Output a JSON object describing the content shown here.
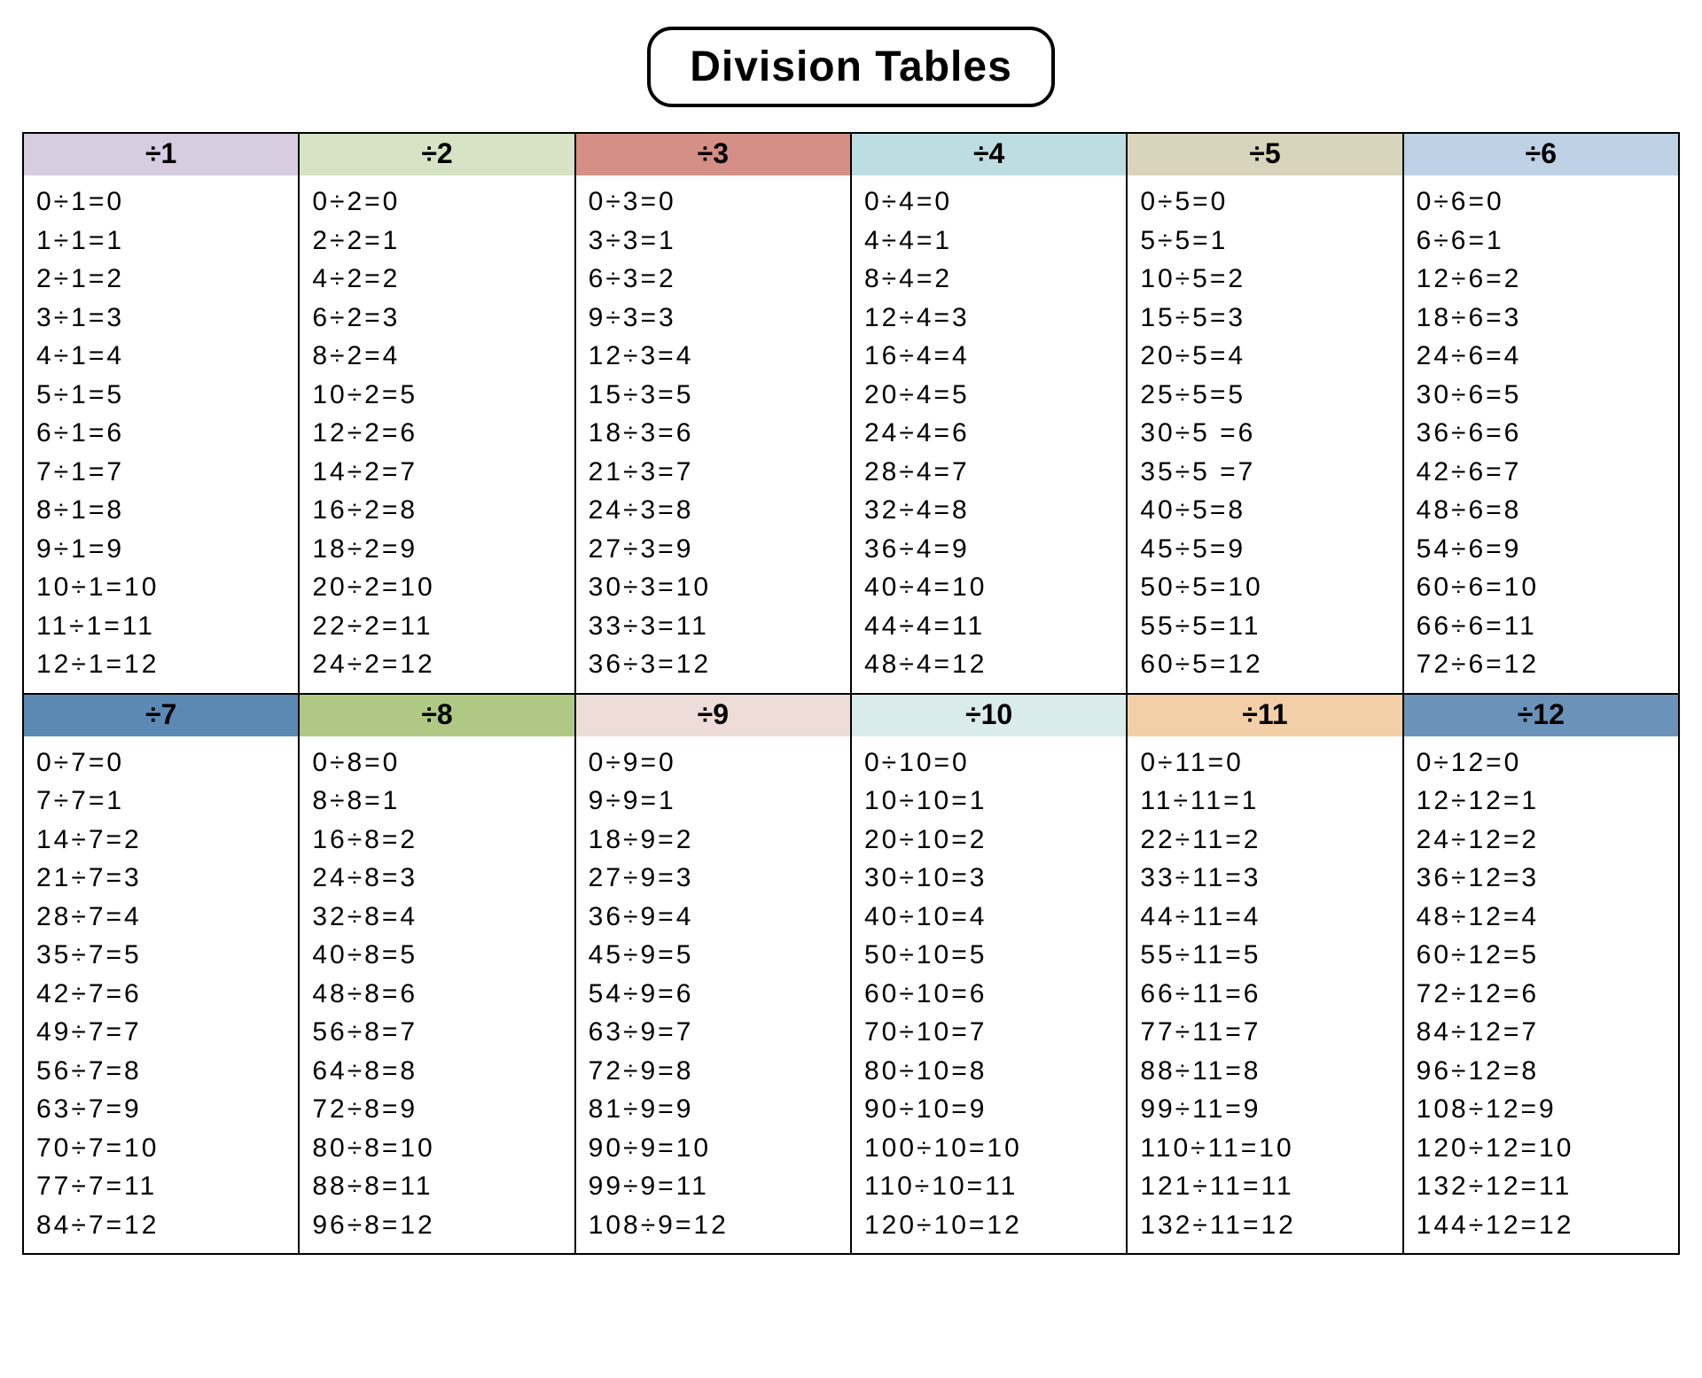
{
  "title": "Division Tables",
  "colors": [
    "#d8cde0",
    "#d6e3c4",
    "#d48f86",
    "#bedde2",
    "#d9d5bd",
    "#bed1e5",
    "#5b89b4",
    "#afc883",
    "#eddcd7",
    "#d9ebeb",
    "#f2cfa7",
    "#6b93ba"
  ],
  "tables": [
    {
      "divisor": 1,
      "header": "÷1",
      "rows": [
        "0÷1=0",
        "1÷1=1",
        "2÷1=2",
        "3÷1=3",
        "4÷1=4",
        "5÷1=5",
        "6÷1=6",
        "7÷1=7",
        "8÷1=8",
        "9÷1=9",
        "10÷1=10",
        "11÷1=11",
        "12÷1=12"
      ]
    },
    {
      "divisor": 2,
      "header": "÷2",
      "rows": [
        "0÷2=0",
        "2÷2=1",
        "4÷2=2",
        "6÷2=3",
        "8÷2=4",
        "10÷2=5",
        "12÷2=6",
        "14÷2=7",
        "16÷2=8",
        "18÷2=9",
        "20÷2=10",
        "22÷2=11",
        "24÷2=12"
      ]
    },
    {
      "divisor": 3,
      "header": "÷3",
      "rows": [
        "0÷3=0",
        "3÷3=1",
        "6÷3=2",
        "9÷3=3",
        "12÷3=4",
        "15÷3=5",
        "18÷3=6",
        "21÷3=7",
        "24÷3=8",
        "27÷3=9",
        "30÷3=10",
        "33÷3=11",
        "36÷3=12"
      ]
    },
    {
      "divisor": 4,
      "header": "÷4",
      "rows": [
        "0÷4=0",
        "4÷4=1",
        "8÷4=2",
        "12÷4=3",
        "16÷4=4",
        "20÷4=5",
        "24÷4=6",
        "28÷4=7",
        "32÷4=8",
        "36÷4=9",
        "40÷4=10",
        "44÷4=11",
        "48÷4=12"
      ]
    },
    {
      "divisor": 5,
      "header": "÷5",
      "rows": [
        "0÷5=0",
        "5÷5=1",
        "10÷5=2",
        "15÷5=3",
        "20÷5=4",
        "25÷5=5",
        "30÷5 =6",
        "35÷5 =7",
        "40÷5=8",
        "45÷5=9",
        "50÷5=10",
        "55÷5=11",
        "60÷5=12"
      ]
    },
    {
      "divisor": 6,
      "header": "÷6",
      "rows": [
        "0÷6=0",
        "6÷6=1",
        "12÷6=2",
        "18÷6=3",
        "24÷6=4",
        "30÷6=5",
        "36÷6=6",
        "42÷6=7",
        "48÷6=8",
        "54÷6=9",
        "60÷6=10",
        "66÷6=11",
        "72÷6=12"
      ]
    },
    {
      "divisor": 7,
      "header": "÷7",
      "rows": [
        "0÷7=0",
        "7÷7=1",
        "14÷7=2",
        "21÷7=3",
        "28÷7=4",
        "35÷7=5",
        "42÷7=6",
        "49÷7=7",
        "56÷7=8",
        "63÷7=9",
        "70÷7=10",
        "77÷7=11",
        "84÷7=12"
      ]
    },
    {
      "divisor": 8,
      "header": "÷8",
      "rows": [
        "0÷8=0",
        "8÷8=1",
        "16÷8=2",
        "24÷8=3",
        "32÷8=4",
        "40÷8=5",
        "48÷8=6",
        "56÷8=7",
        "64÷8=8",
        "72÷8=9",
        "80÷8=10",
        "88÷8=11",
        "96÷8=12"
      ]
    },
    {
      "divisor": 9,
      "header": "÷9",
      "rows": [
        "0÷9=0",
        "9÷9=1",
        "18÷9=2",
        "27÷9=3",
        "36÷9=4",
        "45÷9=5",
        "54÷9=6",
        "63÷9=7",
        "72÷9=8",
        "81÷9=9",
        "90÷9=10",
        "99÷9=11",
        "108÷9=12"
      ]
    },
    {
      "divisor": 10,
      "header": "÷10",
      "rows": [
        "0÷10=0",
        "10÷10=1",
        "20÷10=2",
        "30÷10=3",
        "40÷10=4",
        "50÷10=5",
        "60÷10=6",
        "70÷10=7",
        "80÷10=8",
        "90÷10=9",
        "100÷10=10",
        "110÷10=11",
        "120÷10=12"
      ]
    },
    {
      "divisor": 11,
      "header": "÷11",
      "rows": [
        "0÷11=0",
        "11÷11=1",
        "22÷11=2",
        "33÷11=3",
        "44÷11=4",
        "55÷11=5",
        "66÷11=6",
        "77÷11=7",
        "88÷11=8",
        "99÷11=9",
        "110÷11=10",
        "121÷11=11",
        "132÷11=12"
      ]
    },
    {
      "divisor": 12,
      "header": "÷12",
      "rows": [
        "0÷12=0",
        "12÷12=1",
        "24÷12=2",
        "36÷12=3",
        "48÷12=4",
        "60÷12=5",
        "72÷12=6",
        "84÷12=7",
        "96÷12=8",
        "108÷12=9",
        "120÷12=10",
        "132÷12=11",
        "144÷12=12"
      ]
    }
  ]
}
